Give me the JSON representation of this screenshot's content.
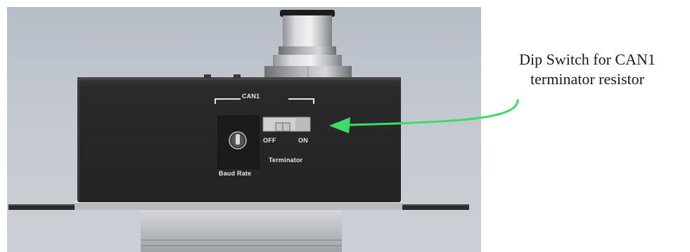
{
  "device": {
    "group_label": "CAN1",
    "switch_off_label": "OFF",
    "switch_on_label": "ON",
    "switch_caption": "Terminator",
    "knob_caption": "Baud Rate",
    "switch_state": "OFF"
  },
  "callout": {
    "line1": "Dip Switch for CAN1",
    "line2": "terminator resistor",
    "arrow_color": "#3ddc6a"
  },
  "colors": {
    "background": "#c4c9d1",
    "enclosure": "#2b2b2b",
    "connector_metal": "#c9c9c9",
    "label_text": "#e8e8e8"
  }
}
